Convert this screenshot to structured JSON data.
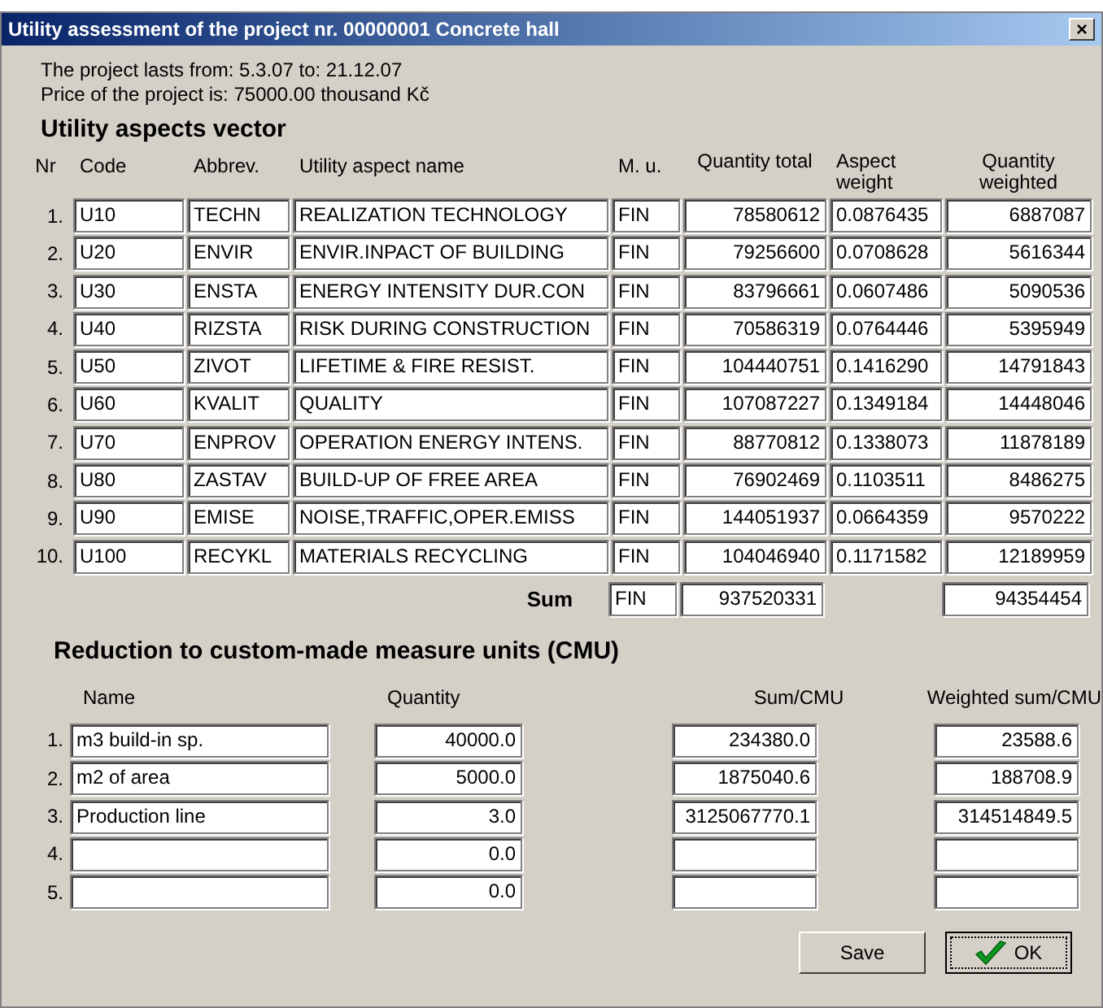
{
  "window": {
    "title": "Utility assessment of the project nr. 00000001 Concrete hall",
    "close": "×"
  },
  "info": [
    "The project lasts from: 5.3.07 to: 21.12.07",
    "Price of the project is: 75000.00 thousand Kč"
  ],
  "aspects": {
    "heading": "Utility aspects vector",
    "columns": [
      "Nr",
      "Code",
      "Abbrev.",
      "Utility aspect name",
      "M. u.",
      "Quantity total",
      "Aspect weight",
      "Quantity weighted"
    ],
    "rows": [
      {
        "nr": "1.",
        "code": "U10",
        "abbrev": "TECHN",
        "name": "REALIZATION TECHNOLOGY",
        "mu": "FIN",
        "total": "78580612",
        "weight": "0.0876435",
        "weighted": "6887087"
      },
      {
        "nr": "2.",
        "code": "U20",
        "abbrev": "ENVIR",
        "name": "ENVIR.INPACT OF BUILDING",
        "mu": "FIN",
        "total": "79256600",
        "weight": "0.0708628",
        "weighted": "5616344"
      },
      {
        "nr": "3.",
        "code": "U30",
        "abbrev": "ENSTA",
        "name": "ENERGY INTENSITY DUR.CON",
        "mu": "FIN",
        "total": "83796661",
        "weight": "0.0607486",
        "weighted": "5090536"
      },
      {
        "nr": "4.",
        "code": "U40",
        "abbrev": "RIZSTA",
        "name": "RISK DURING CONSTRUCTION",
        "mu": "FIN",
        "total": "70586319",
        "weight": "0.0764446",
        "weighted": "5395949"
      },
      {
        "nr": "5.",
        "code": "U50",
        "abbrev": "ZIVOT",
        "name": "LIFETIME & FIRE RESIST.",
        "mu": "FIN",
        "total": "104440751",
        "weight": "0.1416290",
        "weighted": "14791843"
      },
      {
        "nr": "6.",
        "code": "U60",
        "abbrev": "KVALIT",
        "name": "QUALITY",
        "mu": "FIN",
        "total": "107087227",
        "weight": "0.1349184",
        "weighted": "14448046"
      },
      {
        "nr": "7.",
        "code": "U70",
        "abbrev": "ENPROV",
        "name": "OPERATION ENERGY INTENS.",
        "mu": "FIN",
        "total": "88770812",
        "weight": "0.1338073",
        "weighted": "11878189"
      },
      {
        "nr": "8.",
        "code": "U80",
        "abbrev": "ZASTAV",
        "name": "BUILD-UP OF FREE AREA",
        "mu": "FIN",
        "total": "76902469",
        "weight": "0.1103511",
        "weighted": "8486275"
      },
      {
        "nr": "9.",
        "code": "U90",
        "abbrev": "EMISE",
        "name": "NOISE,TRAFFIC,OPER.EMISS",
        "mu": "FIN",
        "total": "144051937",
        "weight": "0.0664359",
        "weighted": "9570222"
      },
      {
        "nr": "10.",
        "code": "U100",
        "abbrev": "RECYKL",
        "name": "MATERIALS RECYCLING",
        "mu": "FIN",
        "total": "104046940",
        "weight": "0.1171582",
        "weighted": "12189959"
      }
    ],
    "sum": {
      "label": "Sum",
      "mu": "FIN",
      "total": "937520331",
      "weighted": "94354454"
    }
  },
  "cmu": {
    "heading": "Reduction to custom-made measure units (CMU)",
    "columns": [
      "Name",
      "Quantity",
      "Sum/CMU",
      "Weighted sum/CMU"
    ],
    "rows": [
      {
        "nr": "1.",
        "name": "m3 build-in sp.",
        "quantity": "40000.0",
        "sum": "234380.0",
        "weighted": "23588.6"
      },
      {
        "nr": "2.",
        "name": "m2 of area",
        "quantity": "5000.0",
        "sum": "1875040.6",
        "weighted": "188708.9"
      },
      {
        "nr": "3.",
        "name": "Production line",
        "quantity": "3.0",
        "sum": "3125067770.1",
        "weighted": "314514849.5"
      },
      {
        "nr": "4.",
        "quantity": "0.0"
      },
      {
        "nr": "5.",
        "quantity": "0.0"
      }
    ]
  },
  "buttons": [
    {
      "label": "Save",
      "kind": "plain"
    },
    {
      "label": "OK",
      "kind": "check"
    }
  ]
}
